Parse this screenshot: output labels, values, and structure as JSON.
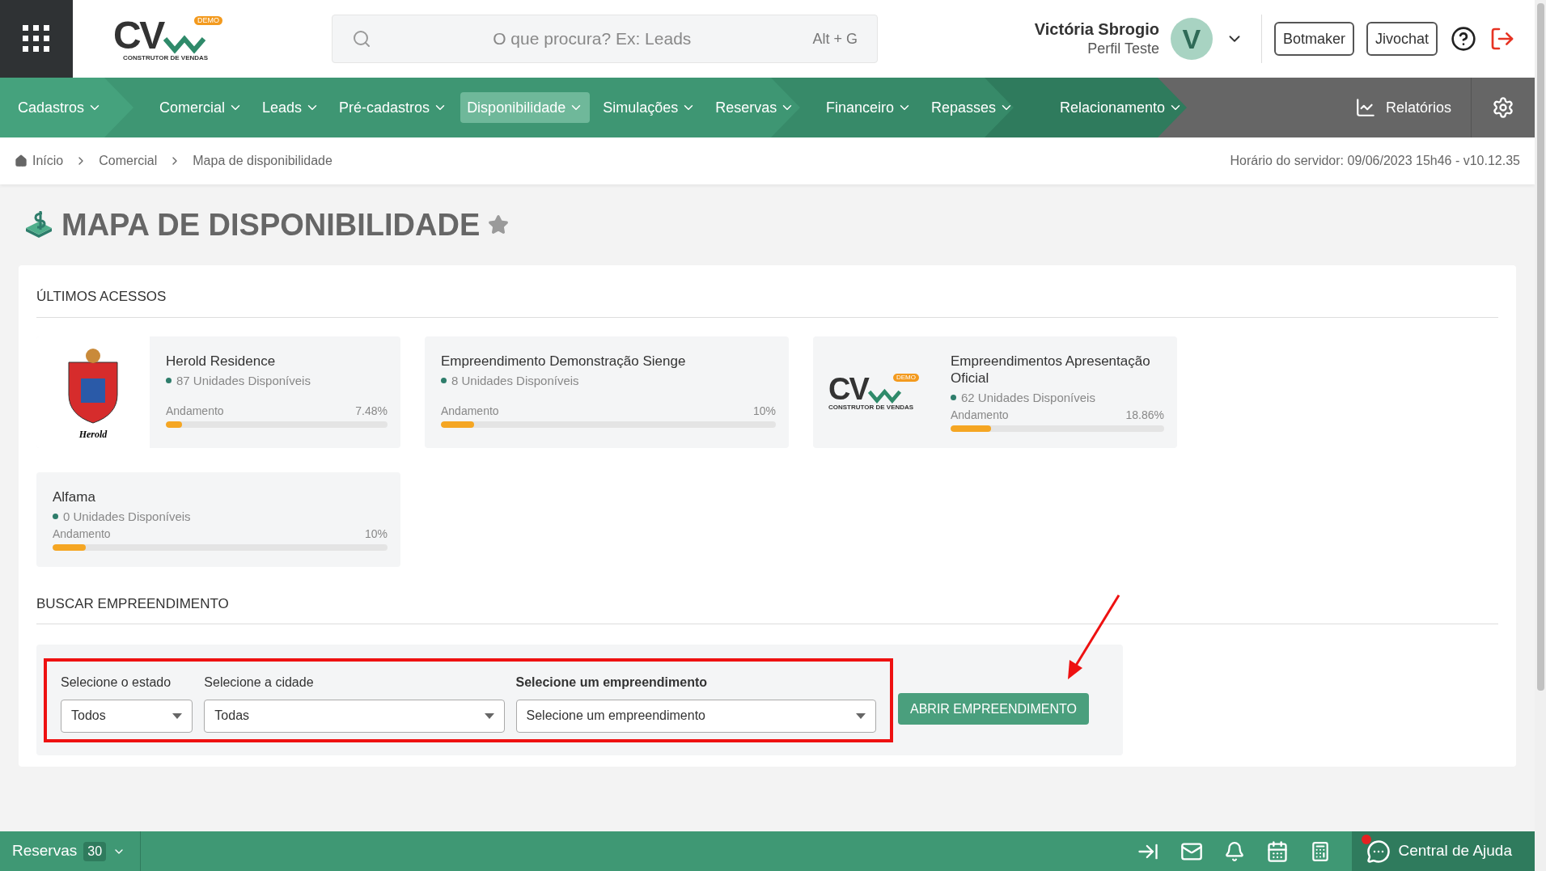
{
  "header": {
    "logo": {
      "mark": "CV",
      "badge": "DEMO",
      "tagline": "CONSTRUTOR DE VENDAS"
    },
    "search": {
      "placeholder": "O que procura? Ex: Leads",
      "shortcut": "Alt + G"
    },
    "user": {
      "name": "Victória Sbrogio",
      "role": "Perfil Teste",
      "initial": "V"
    },
    "buttons": [
      "Botmaker",
      "Jivochat"
    ]
  },
  "nav": {
    "sections": [
      {
        "items": [
          {
            "label": "Cadastros",
            "selected": false
          }
        ]
      },
      {
        "items": [
          {
            "label": "Comercial",
            "selected": false
          },
          {
            "label": "Leads",
            "selected": false
          },
          {
            "label": "Pré-cadastros",
            "selected": false
          },
          {
            "label": "Disponibilidade",
            "selected": true
          },
          {
            "label": "Simulações",
            "selected": false
          },
          {
            "label": "Reservas",
            "selected": false
          }
        ]
      },
      {
        "items": [
          {
            "label": "Financeiro",
            "selected": false
          },
          {
            "label": "Repasses",
            "selected": false
          }
        ]
      },
      {
        "items": [
          {
            "label": "Relacionamento",
            "selected": false
          }
        ]
      }
    ],
    "reports": "Relatórios"
  },
  "breadcrumb": {
    "items": [
      "Início",
      "Comercial",
      "Mapa de disponibilidade"
    ],
    "server_time": "Horário do servidor: 09/06/2023 15h46 - v10.12.35"
  },
  "page": {
    "title": "MAPA DE DISPONIBILIDADE",
    "favorite": false
  },
  "recent": {
    "heading": "ÚLTIMOS ACESSOS",
    "cards": [
      {
        "kind": "crest",
        "crest_caption": "Herold",
        "name": "Herold Residence",
        "units": "87 Unidades Disponíveis",
        "progress_label": "Andamento",
        "percent": "7.48%",
        "level": 0.0748
      },
      {
        "kind": "plain",
        "name": "Empreendimento Demonstração Sienge",
        "units": "8 Unidades Disponíveis",
        "progress_label": "Andamento",
        "percent": "10%",
        "level": 0.1
      },
      {
        "kind": "logo",
        "logo": {
          "mark": "CV",
          "badge": "DEMO",
          "tagline": "CONSTRUTOR DE VENDAS"
        },
        "name": "Empreendimentos Apresentação Oficial",
        "units": "62 Unidades Disponíveis",
        "progress_label": "Andamento",
        "percent": "18.86%",
        "level": 0.1886
      },
      {
        "kind": "plain",
        "name": "Alfama",
        "units": "0 Unidades Disponíveis",
        "progress_label": "Andamento",
        "percent": "10%",
        "level": 0.1
      }
    ]
  },
  "search": {
    "heading": "BUSCAR EMPREENDIMENTO",
    "fields": [
      {
        "label": "Selecione o estado",
        "value": "Todos",
        "emphasized": false
      },
      {
        "label": "Selecione a cidade",
        "value": "Todas",
        "emphasized": false
      },
      {
        "label": "Selecione um empreendimento",
        "value": "Selecione um empreendimento",
        "emphasized": true
      }
    ],
    "button": "ABRIR EMPREENDIMENTO"
  },
  "bottom_bar": {
    "label": "Reservas",
    "count": "30",
    "help": "Central de Ajuda",
    "help_notification": true
  }
}
